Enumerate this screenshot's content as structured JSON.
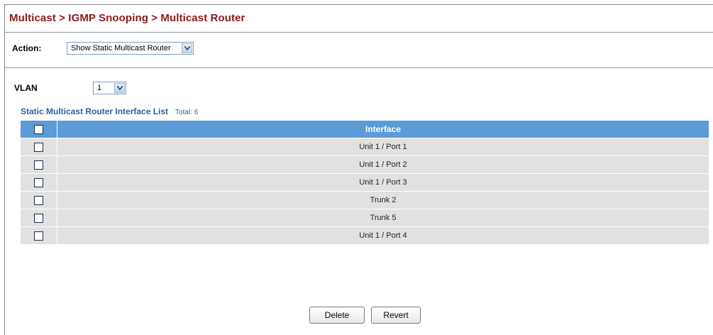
{
  "breadcrumb": "Multicast > IGMP Snooping > Multicast Router",
  "action": {
    "label": "Action:",
    "selected": "Show Static Multicast Router"
  },
  "vlan": {
    "label": "VLAN",
    "selected": "1"
  },
  "list": {
    "title": "Static Multicast Router Interface List",
    "total": "Total: 6",
    "header": "Interface",
    "rows": [
      "Unit 1 / Port 1",
      "Unit 1 / Port 2",
      "Unit 1 / Port 3",
      "Trunk 2",
      "Trunk 5",
      "Unit 1 / Port 4"
    ]
  },
  "buttons": {
    "delete": "Delete",
    "revert": "Revert"
  },
  "icons": {
    "dropdown": "chevron-down-icon",
    "checkbox": "checkbox-icon"
  },
  "colors": {
    "title": "#8b1a1a",
    "header_bg": "#5b9bd8",
    "row_bg": "#e1e1e1",
    "list_title": "#2f5f9f"
  }
}
